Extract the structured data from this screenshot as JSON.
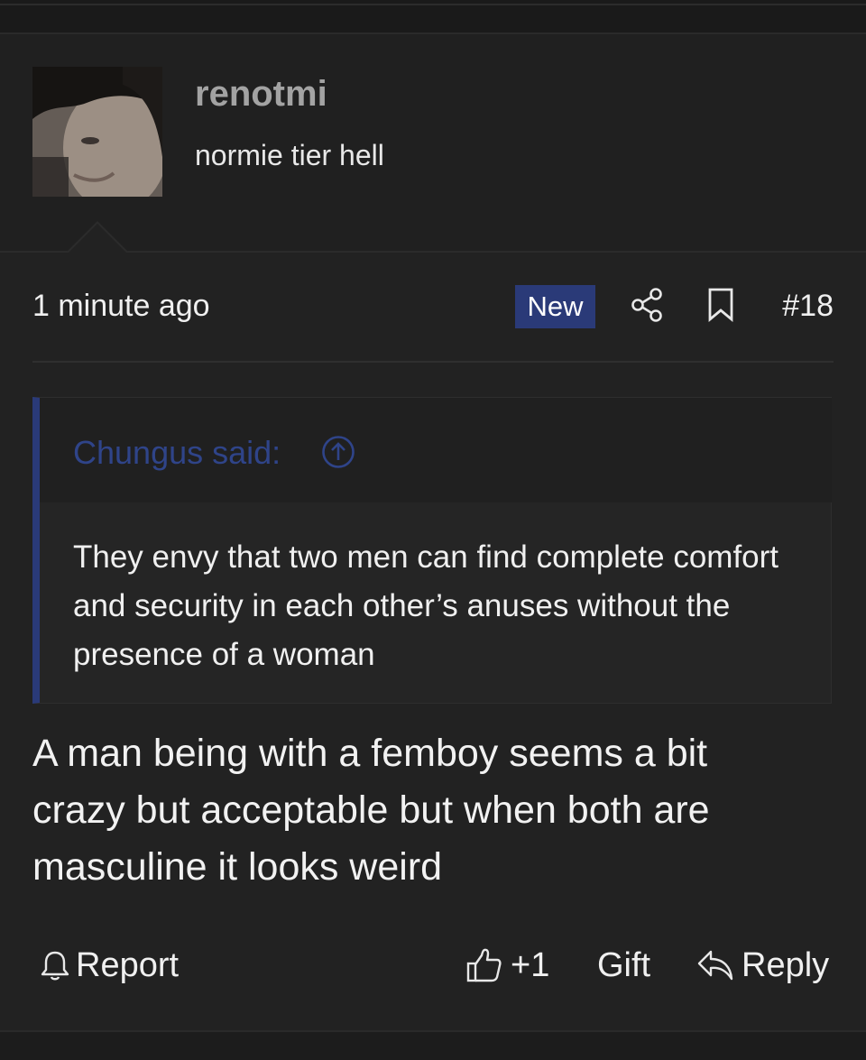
{
  "post": {
    "author": {
      "username": "renotmi",
      "title": "normie tier hell"
    },
    "timestamp": "1 minute ago",
    "badge": "New",
    "number": "#18",
    "quote": {
      "author_label": "Chungus said:",
      "text": "They envy that two men can find complete comfort and security in each other’s anuses without the presence of a woman"
    },
    "message": "A man being with a femboy seems a bit crazy but acceptable but when both are masculine it looks weird",
    "actions": {
      "report": "Report",
      "like": "+1",
      "gift": "Gift",
      "reply": "Reply"
    }
  },
  "colors": {
    "accent": "#2a3a78",
    "quote_link": "#2f4489",
    "background": "#222222"
  },
  "icons": [
    "share-icon",
    "bookmark-icon",
    "arrow-up-circle-icon",
    "bell-icon",
    "thumbs-up-icon",
    "reply-icon"
  ]
}
